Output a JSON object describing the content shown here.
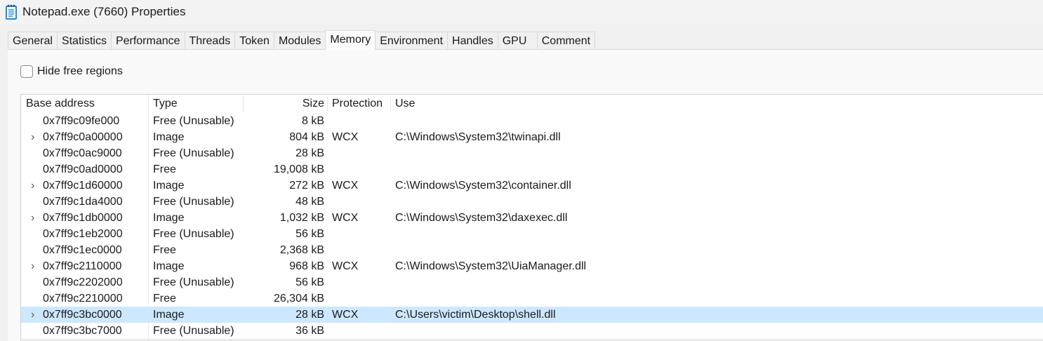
{
  "window": {
    "title": "Notepad.exe (7660) Properties",
    "icon": "notepad-icon"
  },
  "tabs": [
    {
      "label": "General"
    },
    {
      "label": "Statistics"
    },
    {
      "label": "Performance"
    },
    {
      "label": "Threads"
    },
    {
      "label": "Token"
    },
    {
      "label": "Modules"
    },
    {
      "label": "Memory",
      "active": true
    },
    {
      "label": "Environment"
    },
    {
      "label": "Handles"
    },
    {
      "label": "GPU"
    },
    {
      "label": "Comment"
    }
  ],
  "options": {
    "hide_free_label": "Hide free regions",
    "hide_free_checked": false
  },
  "table": {
    "columns": [
      "Base address",
      "Type",
      "Size",
      "Protection",
      "Use"
    ],
    "rows": [
      {
        "expand": "",
        "address": "0x7ff9c09fe000",
        "type": "Free (Unusable)",
        "size": "8 kB",
        "protection": "",
        "use": ""
      },
      {
        "expand": "›",
        "address": "0x7ff9c0a00000",
        "type": "Image",
        "size": "804 kB",
        "protection": "WCX",
        "use": "C:\\Windows\\System32\\twinapi.dll"
      },
      {
        "expand": "",
        "address": "0x7ff9c0ac9000",
        "type": "Free (Unusable)",
        "size": "28 kB",
        "protection": "",
        "use": ""
      },
      {
        "expand": "",
        "address": "0x7ff9c0ad0000",
        "type": "Free",
        "size": "19,008 kB",
        "protection": "",
        "use": ""
      },
      {
        "expand": "›",
        "address": "0x7ff9c1d60000",
        "type": "Image",
        "size": "272 kB",
        "protection": "WCX",
        "use": "C:\\Windows\\System32\\container.dll"
      },
      {
        "expand": "",
        "address": "0x7ff9c1da4000",
        "type": "Free (Unusable)",
        "size": "48 kB",
        "protection": "",
        "use": ""
      },
      {
        "expand": "›",
        "address": "0x7ff9c1db0000",
        "type": "Image",
        "size": "1,032 kB",
        "protection": "WCX",
        "use": "C:\\Windows\\System32\\daxexec.dll"
      },
      {
        "expand": "",
        "address": "0x7ff9c1eb2000",
        "type": "Free (Unusable)",
        "size": "56 kB",
        "protection": "",
        "use": ""
      },
      {
        "expand": "",
        "address": "0x7ff9c1ec0000",
        "type": "Free",
        "size": "2,368 kB",
        "protection": "",
        "use": ""
      },
      {
        "expand": "›",
        "address": "0x7ff9c2110000",
        "type": "Image",
        "size": "968 kB",
        "protection": "WCX",
        "use": "C:\\Windows\\System32\\UiaManager.dll"
      },
      {
        "expand": "",
        "address": "0x7ff9c2202000",
        "type": "Free (Unusable)",
        "size": "56 kB",
        "protection": "",
        "use": ""
      },
      {
        "expand": "",
        "address": "0x7ff9c2210000",
        "type": "Free",
        "size": "26,304 kB",
        "protection": "",
        "use": ""
      },
      {
        "expand": "›",
        "address": "0x7ff9c3bc0000",
        "type": "Image",
        "size": "28 kB",
        "protection": "WCX",
        "use": "C:\\Users\\victim\\Desktop\\shell.dll",
        "selected": true
      },
      {
        "expand": "",
        "address": "0x7ff9c3bc7000",
        "type": "Free (Unusable)",
        "size": "36 kB",
        "protection": "",
        "use": ""
      }
    ]
  },
  "colors": {
    "selection": "#cce8ff",
    "icon_blue": "#1e88e5"
  }
}
